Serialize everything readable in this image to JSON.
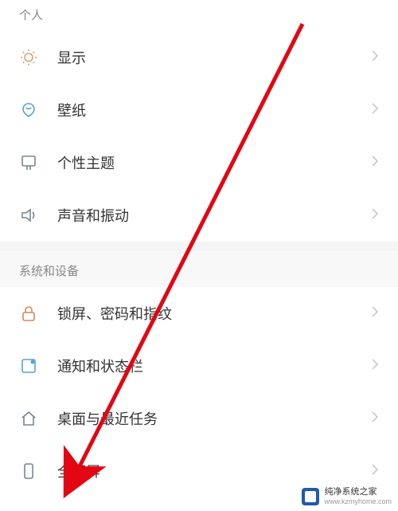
{
  "sections": [
    {
      "header": "个人",
      "items": [
        {
          "key": "display",
          "label": "显示",
          "icon": "display"
        },
        {
          "key": "wallpaper",
          "label": "壁纸",
          "icon": "wallpaper"
        },
        {
          "key": "theme",
          "label": "个性主题",
          "icon": "theme"
        },
        {
          "key": "sound",
          "label": "声音和振动",
          "icon": "sound"
        }
      ]
    },
    {
      "header": "系统和设备",
      "items": [
        {
          "key": "lock",
          "label": "锁屏、密码和指纹",
          "icon": "lock"
        },
        {
          "key": "notif",
          "label": "通知和状态栏",
          "icon": "notif"
        },
        {
          "key": "home",
          "label": "桌面与最近任务",
          "icon": "home"
        },
        {
          "key": "fullscreen",
          "label": "全面屏",
          "icon": "fullscreen"
        }
      ]
    }
  ],
  "watermark": {
    "line1": "纯净系统之家",
    "line2": "www.kzmyhome.com"
  },
  "annotation": {
    "arrow_color": "#e30613"
  }
}
